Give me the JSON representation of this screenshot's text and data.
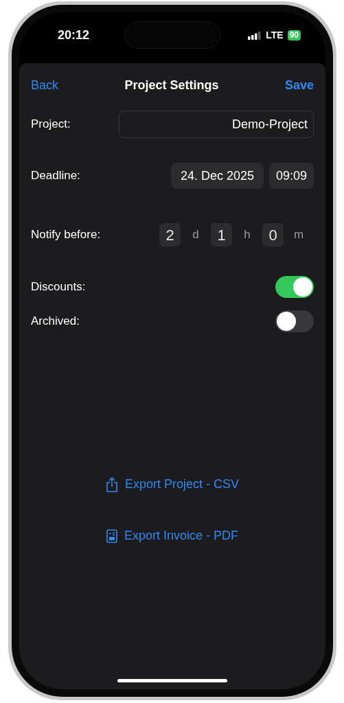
{
  "status_bar": {
    "time": "20:12",
    "network": "LTE",
    "battery": "90"
  },
  "nav": {
    "back": "Back",
    "title": "Project Settings",
    "save": "Save"
  },
  "project": {
    "label": "Project:",
    "value": "Demo-Project"
  },
  "deadline": {
    "label": "Deadline:",
    "date": "24. Dec 2025",
    "time": "09:09"
  },
  "notify": {
    "label": "Notify before:",
    "units": [
      {
        "value": "2",
        "unit": "d"
      },
      {
        "value": "1",
        "unit": "h"
      },
      {
        "value": "0",
        "unit": "m"
      }
    ]
  },
  "toggles": [
    {
      "label": "Discounts:",
      "on": true
    },
    {
      "label": "Archived:",
      "on": false
    }
  ],
  "actions": [
    {
      "label": "Export Project - CSV",
      "kind": "share"
    },
    {
      "label": "Export Invoice - PDF",
      "kind": "invoice"
    }
  ]
}
